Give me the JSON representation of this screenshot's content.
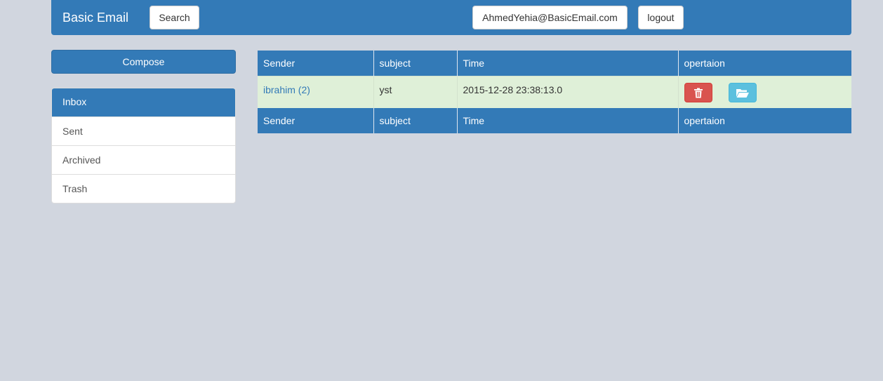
{
  "navbar": {
    "brand": "Basic Email",
    "search_label": "Search",
    "user_email": "AhmedYehia@BasicEmail.com",
    "logout_label": "logout"
  },
  "sidebar": {
    "compose_label": "Compose",
    "folders": [
      {
        "label": "Inbox",
        "active": true
      },
      {
        "label": "Sent"
      },
      {
        "label": "Archived"
      },
      {
        "label": "Trash"
      }
    ]
  },
  "table": {
    "headers": [
      "Sender",
      "subject",
      "Time",
      "opertaion"
    ],
    "rows": [
      {
        "sender": "ibrahim (2)",
        "subject": "yst",
        "time": "2015-12-28 23:38:13.0",
        "actions": [
          "trash-icon",
          "folder-open-icon"
        ]
      }
    ],
    "footer": [
      "Sender",
      "subject",
      "Time",
      "opertaion"
    ]
  },
  "colors": {
    "primary": "#337ab7",
    "background": "#d1d6df",
    "row_success": "#dff0d8",
    "danger": "#d9534f",
    "info": "#5bc0de"
  }
}
